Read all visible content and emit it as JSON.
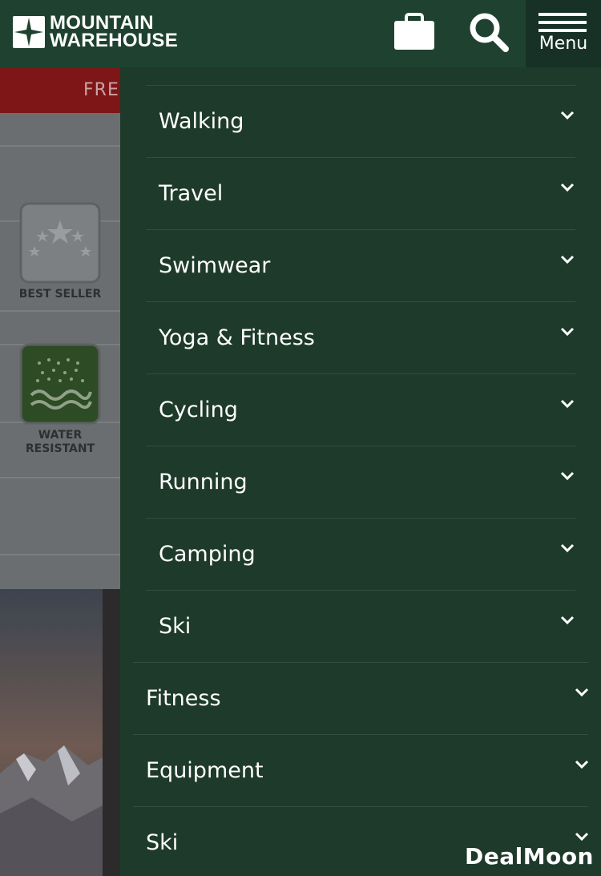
{
  "header": {
    "logo_line1": "MOUNTAIN",
    "logo_line2": "WAREHOUSE",
    "bag_icon": "shopping-bag-icon",
    "search_icon": "search-icon",
    "menu_label": "Menu",
    "background": "#1f4230"
  },
  "page": {
    "promo_text": "FRE",
    "features": [
      {
        "label": "BEST SELLER",
        "icon": "stars-badge-icon"
      },
      {
        "label_line1": "WATER",
        "label_line2": "RESISTANT",
        "icon": "rain-drops-icon"
      }
    ]
  },
  "drawer": {
    "background": "#1e3a2a",
    "sub_items": [
      {
        "label": "Walking"
      },
      {
        "label": "Travel"
      },
      {
        "label": "Swimwear"
      },
      {
        "label": "Yoga & Fitness"
      },
      {
        "label": "Cycling"
      },
      {
        "label": "Running"
      },
      {
        "label": "Camping"
      },
      {
        "label": "Ski"
      }
    ],
    "top_items": [
      {
        "label": "Fitness"
      },
      {
        "label": "Equipment"
      },
      {
        "label": "Ski"
      }
    ]
  },
  "watermark": "DealMoon"
}
